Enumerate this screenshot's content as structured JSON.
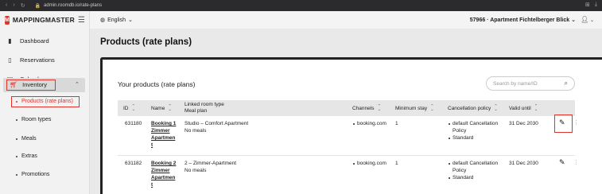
{
  "browser": {
    "url": "admin.roomdb.io/rate-plans"
  },
  "brand": {
    "logo_letter": "M",
    "name": "MAPPINGMASTER"
  },
  "sidebar": {
    "items": [
      {
        "label": "Dashboard",
        "icon": "bar-chart-icon"
      },
      {
        "label": "Reservations",
        "icon": "book-icon"
      },
      {
        "label": "Calendar",
        "icon": "calendar-icon"
      },
      {
        "label": "Inventory",
        "icon": "cart-icon"
      }
    ],
    "inventory_sub": [
      {
        "label": "Products (rate plans)",
        "active": true
      },
      {
        "label": "Room types",
        "active": false
      },
      {
        "label": "Meals",
        "active": false
      },
      {
        "label": "Extras",
        "active": false
      },
      {
        "label": "Promotions",
        "active": false
      }
    ]
  },
  "topbar": {
    "language": "English",
    "property": "57966 · Apartment Fichtelberger Blick"
  },
  "page": {
    "title": "Products (rate plans)",
    "card_title": "Your products (rate plans)",
    "search_placeholder": "Search by name/ID"
  },
  "table": {
    "headers": {
      "id": "ID",
      "name": "Name",
      "linked_line1": "Linked room type",
      "linked_line2": "Meal plan",
      "channels": "Channels",
      "min_stay": "Minimum stay",
      "cancellation": "Cancellation policy",
      "valid_until": "Valid until"
    },
    "rows": [
      {
        "id": "631180",
        "name_lines": [
          "Booking 1",
          "Zimmer",
          "Apartmen",
          "t"
        ],
        "room_type": "Studio – Comfort Apartment",
        "meal_plan": "No meals",
        "channel": "booking.com",
        "min_stay": "1",
        "cancellation_lines": [
          "default Cancellation",
          "Policy"
        ],
        "cancellation_extra": "Standard",
        "valid_until": "31 Dec 2030"
      },
      {
        "id": "631182",
        "name_lines": [
          "Booking 2",
          "Zimmer",
          "Apartmen",
          "t"
        ],
        "room_type": "2 – Zimmer-Apartment",
        "meal_plan": "No meals",
        "channel": "booking.com",
        "min_stay": "1",
        "cancellation_lines": [
          "default Cancellation",
          "Policy"
        ],
        "cancellation_extra": "Standard",
        "valid_until": "31 Dec 2030"
      }
    ]
  },
  "colors": {
    "accent_red": "#e0332a",
    "brand_red": "#d9382c"
  }
}
